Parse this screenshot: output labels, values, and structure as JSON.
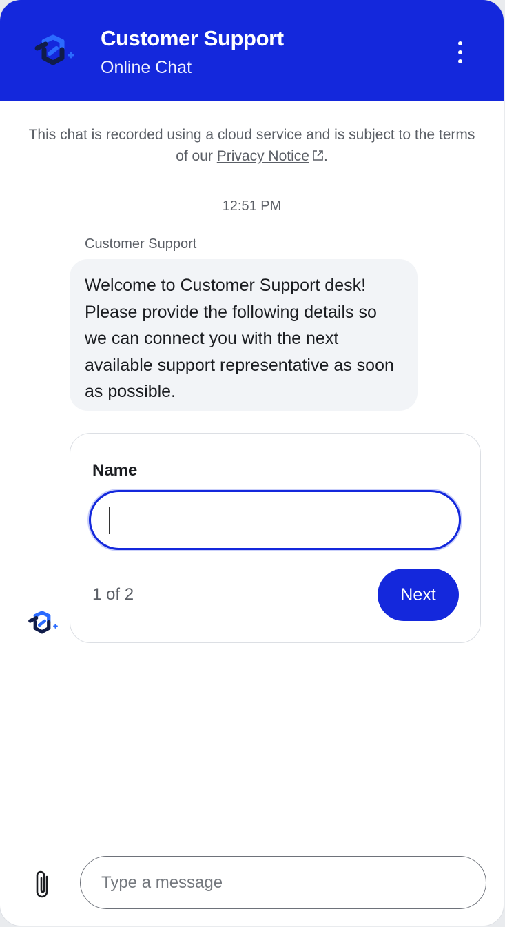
{
  "header": {
    "title": "Customer Support",
    "subtitle": "Online Chat",
    "logo_icon": "brand-link-logo-icon",
    "menu_icon": "more-vertical-icon",
    "background_color": "#1428dc"
  },
  "notice": {
    "text_before": "This chat is recorded using a cloud service and is subject to the terms of our ",
    "link_text": "Privacy Notice",
    "text_after": ".",
    "link_icon": "external-link-icon"
  },
  "conversation": {
    "timestamp": "12:51 PM",
    "sender": "Customer Support",
    "message": "Welcome to Customer Support desk! Please provide the following details so we can connect you with the next available support representative as soon as possible."
  },
  "form": {
    "field_label": "Name",
    "field_value": "",
    "pager": "1 of 2",
    "next_label": "Next"
  },
  "composer": {
    "placeholder": "Type a message",
    "value": "",
    "attach_icon": "paperclip-icon"
  },
  "colors": {
    "accent": "#1428dc",
    "bubble_bg": "#f2f4f7",
    "muted_text": "#5b5f66"
  }
}
